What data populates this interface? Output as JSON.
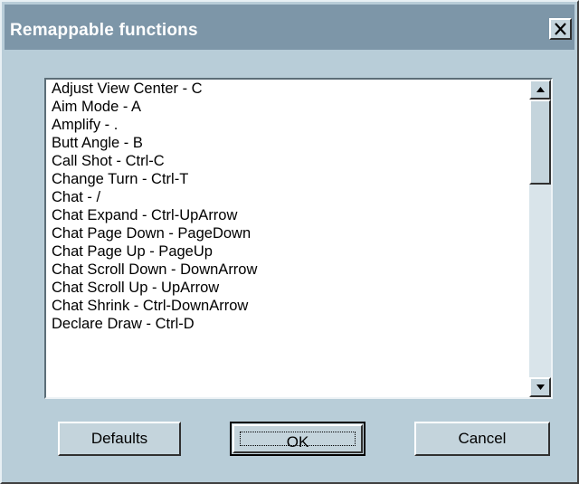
{
  "window": {
    "title": "Remappable functions",
    "close_icon": "close-icon",
    "colors": {
      "background": "#b8cdd8",
      "titlebar": "#7d96a8",
      "button_face": "#c4d4dc",
      "list_background": "#ffffff"
    }
  },
  "list": {
    "items": [
      "Adjust View Center - C",
      "Aim Mode - A",
      "Amplify - .",
      "Butt Angle - B",
      "Call Shot - Ctrl-C",
      "Change Turn - Ctrl-T",
      "Chat - /",
      "Chat Expand - Ctrl-UpArrow",
      "Chat Page Down - PageDown",
      "Chat Page Up - PageUp",
      "Chat Scroll Down - DownArrow",
      "Chat Scroll Up - UpArrow",
      "Chat Shrink - Ctrl-DownArrow",
      "Declare Draw - Ctrl-D"
    ],
    "scroll_up_icon": "arrow-up-icon",
    "scroll_down_icon": "arrow-down-icon"
  },
  "buttons": {
    "defaults": "Defaults",
    "ok": "OK",
    "cancel": "Cancel"
  }
}
